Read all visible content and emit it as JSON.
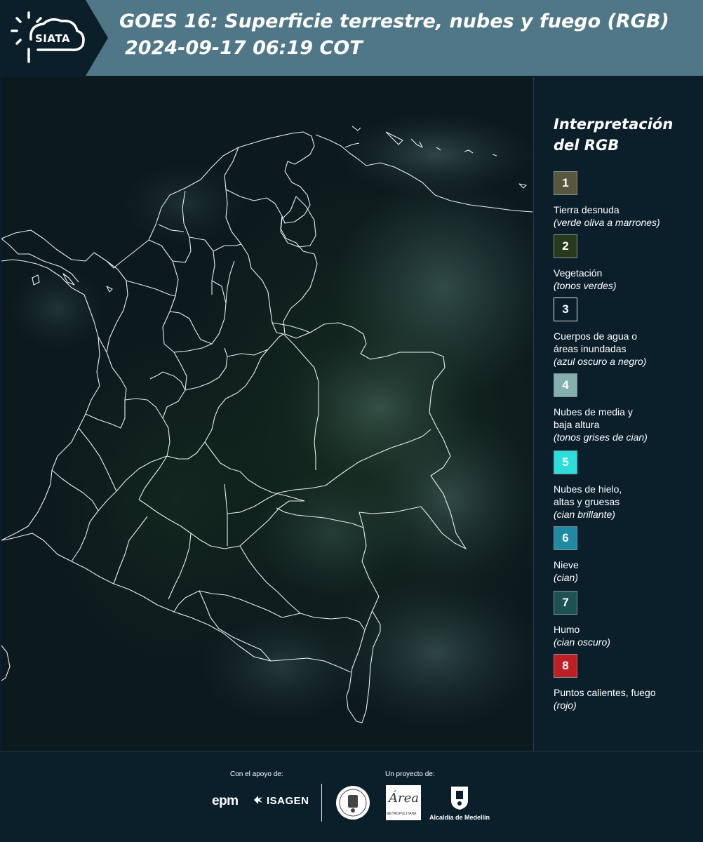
{
  "header": {
    "logo_text": "SIATA",
    "title_line1": "GOES 16: Superficie terrestre, nubes y fuego (RGB)",
    "title_line2": "2024-09-17 06:19 COT"
  },
  "legend": {
    "title": "Interpretación del RGB",
    "items": [
      {
        "num": "1",
        "color": "#58563c",
        "label": "Tierra desnuda",
        "note": "(verde oliva a marrones)"
      },
      {
        "num": "2",
        "color": "#283a1c",
        "label": "Vegetación",
        "note": "(tonos verdes)"
      },
      {
        "num": "3",
        "color": "#0b1f2b",
        "label": "Cuerpos de agua o\náreas inundadas",
        "note": "(azul oscuro a negro)"
      },
      {
        "num": "4",
        "color": "#86b0ad",
        "label": "Nubes de media y\nbaja altura",
        "note": "(tonos grises de cian)"
      },
      {
        "num": "5",
        "color": "#2bdedb",
        "label": "Nubes de hielo,\naltas y gruesas",
        "note": "(cian brillante)"
      },
      {
        "num": "6",
        "color": "#1f8aa1",
        "label": "Nieve",
        "note": "(cian)"
      },
      {
        "num": "7",
        "color": "#1d5152",
        "label": "Humo",
        "note": "(cian oscuro)"
      },
      {
        "num": "8",
        "color": "#bf1f22",
        "label": "Puntos calientes, fuego",
        "note": "(rojo)"
      }
    ]
  },
  "footer": {
    "support_label": "Con el apoyo de:",
    "project_label": "Un proyecto de:",
    "epm": "epm",
    "isagen": "ISAGEN",
    "area_word": "Área",
    "area_sub": "METROPOLITANA",
    "alcaldia": "Alcaldía de Medellín"
  }
}
